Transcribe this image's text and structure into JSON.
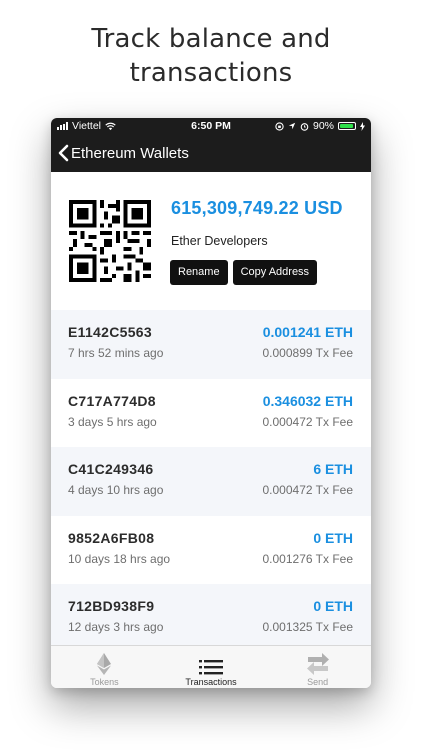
{
  "headline": {
    "line1": "Track balance and",
    "line2": "transactions"
  },
  "status_bar": {
    "carrier": "Viettel",
    "time": "6:50 PM",
    "battery": "90%",
    "battery_level": 0.9,
    "icons": [
      "signal-icon",
      "wifi-icon",
      "orientation-lock-icon",
      "location-icon",
      "alarm-icon",
      "battery-icon",
      "charging-icon"
    ]
  },
  "nav": {
    "back_label": "Ethereum Wallets",
    "back_icon": "chevron-left-icon"
  },
  "wallet": {
    "balance": "615,309,749.22 USD",
    "name": "Ether Developers",
    "rename_label": "Rename",
    "copy_label": "Copy Address",
    "qr_icon": "qr-code-icon"
  },
  "transactions": [
    {
      "hash": "E1142C5563",
      "time": "7 hrs 52 mins ago",
      "amount": "0.001241 ETH",
      "fee": "0.000899 Tx Fee"
    },
    {
      "hash": "C717A774D8",
      "time": "3 days 5 hrs ago",
      "amount": "0.346032 ETH",
      "fee": "0.000472 Tx Fee"
    },
    {
      "hash": "C41C249346",
      "time": "4 days 10 hrs ago",
      "amount": "6 ETH",
      "fee": "0.000472 Tx Fee"
    },
    {
      "hash": "9852A6FB08",
      "time": "10 days 18 hrs ago",
      "amount": "0 ETH",
      "fee": "0.001276 Tx Fee"
    },
    {
      "hash": "712BD938F9",
      "time": "12 days 3 hrs ago",
      "amount": "0 ETH",
      "fee": "0.001325 Tx Fee"
    }
  ],
  "tabs": [
    {
      "label": "Tokens",
      "icon": "ethereum-icon",
      "active": false
    },
    {
      "label": "Transactions",
      "icon": "list-icon",
      "active": true
    },
    {
      "label": "Send",
      "icon": "swap-arrows-icon",
      "active": false
    }
  ],
  "colors": {
    "accent": "#1a8fe0",
    "bar_bg": "#1c1c1c",
    "battery": "#2ee04a"
  }
}
